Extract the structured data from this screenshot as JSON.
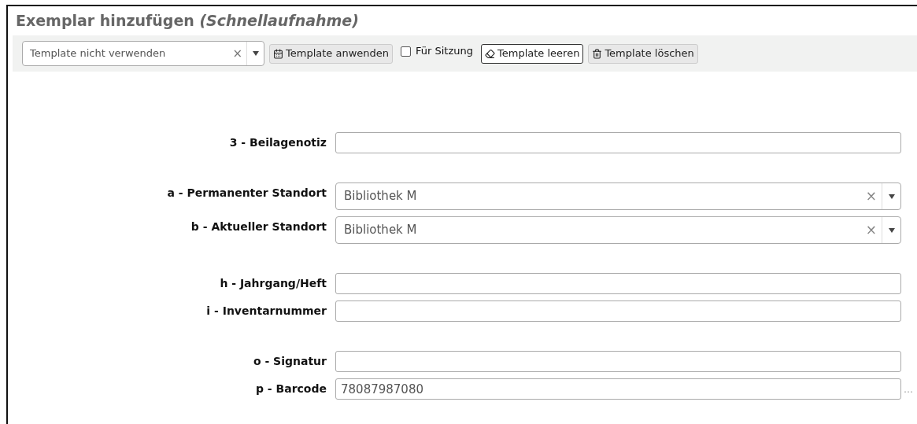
{
  "title": "Exemplar hinzufügen *(Schnellaufnahme)*",
  "toolbar": {
    "template_select": {
      "value": "Template nicht verwenden",
      "clear": "×"
    },
    "buttons": [
      {
        "kind": "apply",
        "label": "Template anwenden",
        "focused": false
      },
      {
        "kind": "checkbox",
        "label": "Für Sitzung",
        "checked": false
      },
      {
        "kind": "empty",
        "label": "Template leeren",
        "focused": true
      },
      {
        "kind": "delete",
        "label": "Template löschen",
        "focused": false
      }
    ]
  },
  "groups": [
    [
      {
        "label": "3 - Beilagenotiz",
        "kind": "text"
      }
    ],
    [
      {
        "label": "a - Permanenter Standort",
        "kind": "select",
        "value": "Bibliothek M",
        "clear": "×"
      },
      {
        "label": "b - Aktueller Standort",
        "kind": "select",
        "value": "Bibliothek M",
        "clear": "×"
      }
    ],
    [
      {
        "label": "h - Jahrgang/Heft",
        "kind": "text"
      },
      {
        "label": "i - Inventarnummer",
        "kind": "text"
      }
    ],
    [
      {
        "label": "o - Signatur",
        "kind": "text"
      },
      {
        "label": "p - Barcode",
        "kind": "text",
        "value": "78087987080",
        "suffix": "…"
      }
    ]
  ]
}
